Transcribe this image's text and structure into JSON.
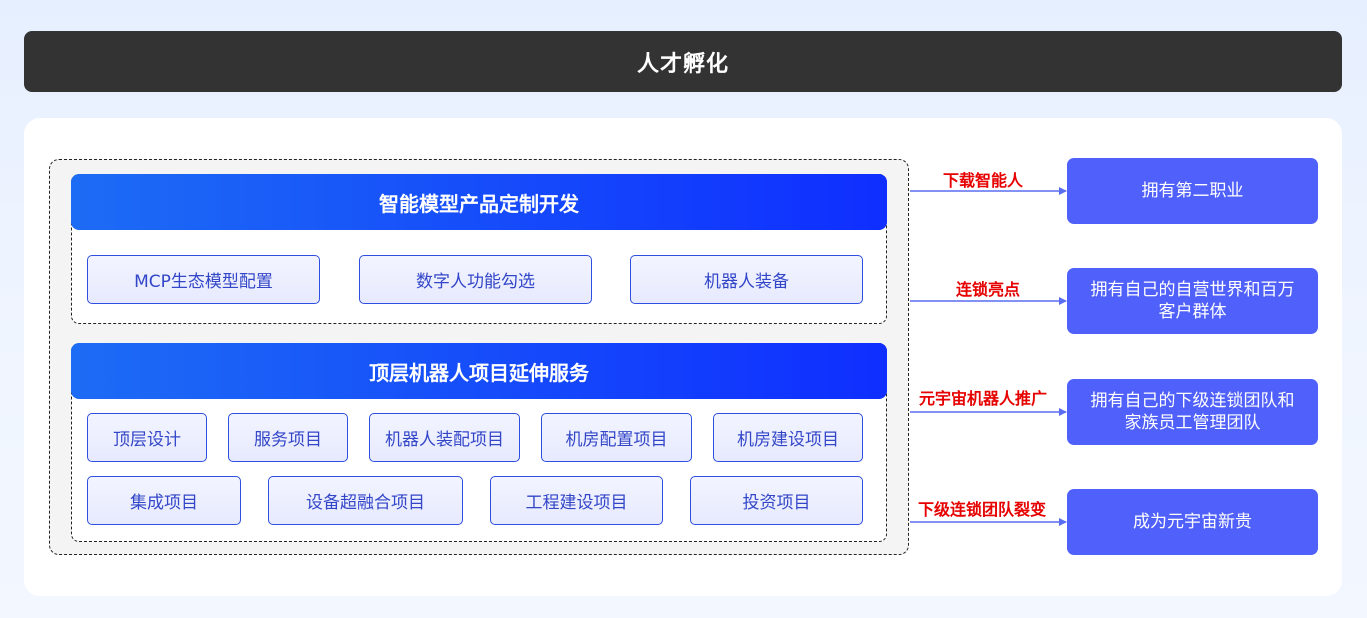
{
  "title": "人才孵化",
  "sections": [
    {
      "header": "智能模型产品定制开发",
      "items": [
        "MCP生态模型配置",
        "数字人功能勾选",
        "机器人装备"
      ]
    },
    {
      "header": "顶层机器人项目延伸服务",
      "row1": [
        "顶层设计",
        "服务项目",
        "机器人装配项目",
        "机房配置项目",
        "机房建设项目"
      ],
      "row2": [
        "集成项目",
        "设备超融合项目",
        "工程建设项目",
        "投资项目"
      ]
    }
  ],
  "flows": [
    {
      "label": "下载智能人",
      "result_lines": [
        "拥有第二职业"
      ]
    },
    {
      "label": "连锁亮点",
      "result_lines": [
        "拥有自己的自营世界和百万",
        "客户群体"
      ]
    },
    {
      "label": "元宇宙机器人推广",
      "result_lines": [
        "拥有自己的下级连锁团队和",
        "家族员工管理团队"
      ]
    },
    {
      "label": "下级连锁团队裂变",
      "result_lines": [
        "成为元宇宙新贵"
      ]
    }
  ],
  "colors": {
    "title_bg": "#333333",
    "header_gradient_start": "#1d6cf5",
    "header_gradient_end": "#0f2eff",
    "result_box": "#5060fa",
    "flow_label": "#e60000",
    "arrow": "#5a6cf0"
  }
}
